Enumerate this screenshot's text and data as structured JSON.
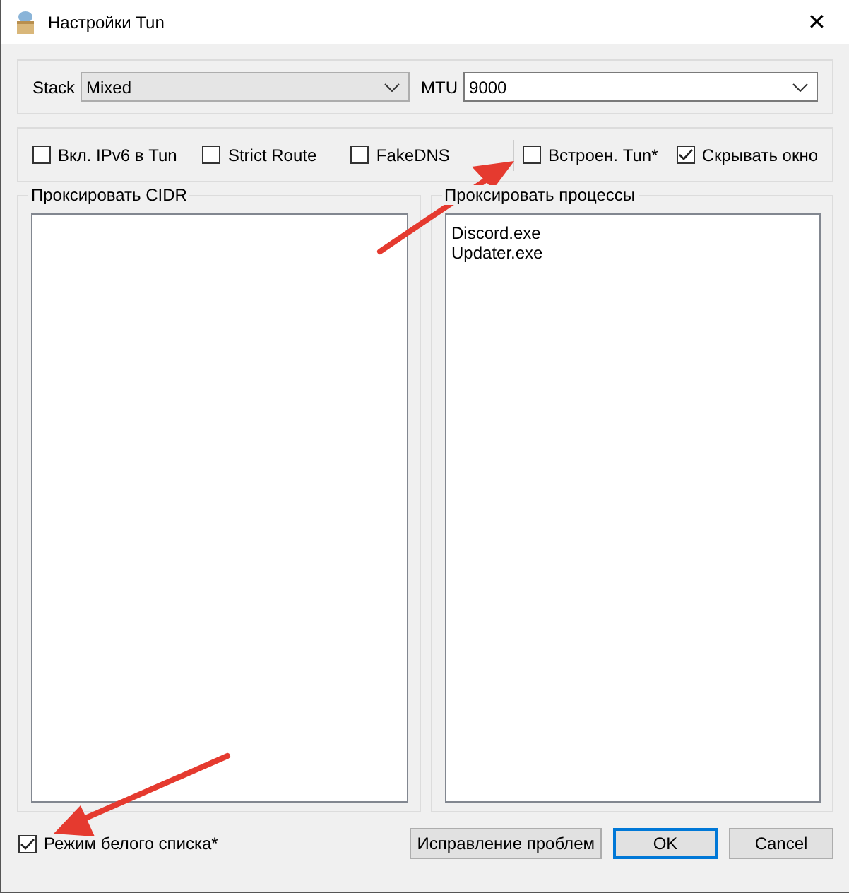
{
  "window": {
    "title": "Настройки Tun",
    "close": "✕"
  },
  "stack": {
    "label": "Stack",
    "value": "Mixed",
    "disabled": true
  },
  "mtu": {
    "label": "MTU",
    "value": "9000",
    "disabled": false
  },
  "options": [
    {
      "label": "Вкл. IPv6 в Tun",
      "checked": false
    },
    {
      "label": "Strict Route",
      "checked": false
    },
    {
      "label": "FakeDNS",
      "checked": false
    },
    {
      "label": "Встроен. Tun*",
      "checked": false
    },
    {
      "label": "Скрывать окно",
      "checked": true
    }
  ],
  "cidr": {
    "title": "Проксировать CIDR"
  },
  "processes": {
    "title": "Проксировать процессы",
    "items": [
      "Discord.exe",
      "Updater.exe"
    ]
  },
  "whitelist": {
    "label": "Режим белого списка*",
    "checked": true
  },
  "buttons": [
    {
      "label": "Исправление проблем",
      "selected": false
    },
    {
      "label": "OK",
      "selected": true
    },
    {
      "label": "Cancel",
      "selected": false
    }
  ]
}
